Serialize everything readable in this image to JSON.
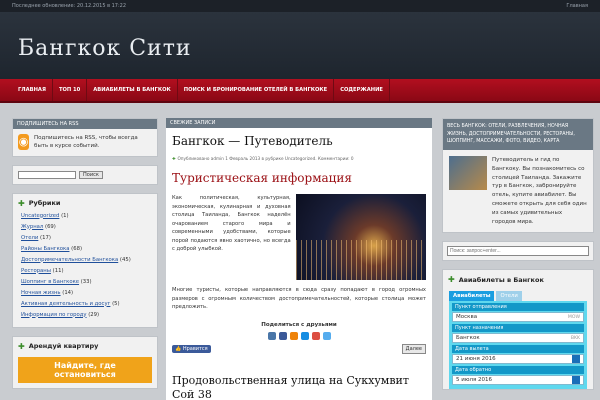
{
  "topbar": {
    "updated": "Последнее обновление: 20.12.2015 в 17:22",
    "home": "Главная"
  },
  "header": {
    "title": "Бангкок  Сити"
  },
  "nav": {
    "items": [
      "ГЛАВНАЯ",
      "ТОП 10",
      "АВИАБИЛЕТЫ В БАНГКОК",
      "ПОИСК И БРОНИРОВАНИЕ ОТЕЛЕЙ В БАНГКОКЕ",
      "СОДЕРЖАНИЕ"
    ]
  },
  "left": {
    "rss_head": "ПОДПИШИТЕСЬ НА RSS",
    "rss_text": "Подпишитесь на RSS, чтобы всегда быть в курсе событий.",
    "search_btn": "Поиск",
    "rubrics_title": "Рубрики",
    "rubrics": [
      {
        "name": "Uncategorized",
        "count": "(1)"
      },
      {
        "name": "Журнал",
        "count": "(69)"
      },
      {
        "name": "Отели",
        "count": "(17)"
      },
      {
        "name": "Районы Бангкока",
        "count": "(68)"
      },
      {
        "name": "Достопримечательности Бангкока",
        "count": "(45)"
      },
      {
        "name": "Рестораны",
        "count": "(11)"
      },
      {
        "name": "Шоппинг в Бангкоке",
        "count": "(33)"
      },
      {
        "name": "Ночная жизнь",
        "count": "(14)"
      },
      {
        "name": "Активная деятельность и досуг",
        "count": "(5)"
      },
      {
        "name": "Информация по городу",
        "count": "(29)"
      }
    ],
    "rent_title": "Арендуй квартиру",
    "rent_btn": "Найдите, где остановиться"
  },
  "main": {
    "head": "СВЕЖИЕ ЗАПИСИ",
    "post_title": "Бангкок  —  Путеводитель",
    "meta": "Опубликовано admin 1 Февраль 2013 в рубрике Uncategorized. Комментарии: 0",
    "h2": "Туристическая  информация",
    "p1": "Как политическая, культурная, экономическая, кулинарная и духовная столица Таиланда, Бангкок наделён очарованием старого мира и современными удобствами, которые порой подаются явно хаотично, но всегда с доброй улыбкой.",
    "p2": "Многие туристы, которые направляются в сюда сразу попадают в город огромных размеров с огромным количеством достопримечательностей, которые столица может предложить.",
    "share": "Поделиться с друзьями",
    "like": "Нравится",
    "more": "Далее",
    "post2": "Продовольственная улица на Сукхумвит Сой 38"
  },
  "right": {
    "tags": "ВЕСЬ БАНГКОК: ОТЕЛИ, РАЗВЛЕЧЕНИЯ, НОЧНАЯ ЖИЗНЬ, ДОСТОПРИМЕЧАТЕЛЬНОСТИ, РЕСТОРАНЫ, ШОППИНГ, МАССАЖИ, ФОТО, ВИДЕО, КАРТА",
    "about": "Путеводитель и гид по Бангкоку. Вы познакомитесь со столицей Таиланда. Закажите тур в Бангкок, забронируйте отель, купите авиабилет. Вы сможете открыть для себя один из самых удивительных городов мира.",
    "search_placeholder": "Поиск: запрос+enter...",
    "avia_title": "Авиабилеты в Бангкок",
    "tab1": "Авиабилеты",
    "tab2": "Отели",
    "from_label": "Пункт отправления",
    "from_value": "Москва",
    "from_code": "MOW",
    "to_label": "Пункт назначения",
    "to_value": "Бангкок",
    "to_code": "BKK",
    "dep_label": "Дата вылета",
    "dep_value": "21 июня 2016",
    "ret_label": "Дата обратно",
    "ret_value": "5 июля 2016"
  }
}
